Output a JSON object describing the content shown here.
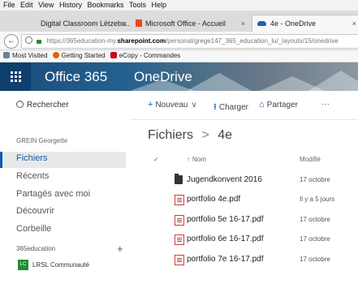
{
  "menubar": [
    "File",
    "Edit",
    "View",
    "History",
    "Bookmarks",
    "Tools",
    "Help"
  ],
  "tabs": [
    {
      "label": "Digital Classroom Lëtzebu...",
      "close": "×"
    },
    {
      "label": "Microsoft Office - Accueil",
      "close": "×"
    },
    {
      "label": "4e - OneDrive",
      "close": "×"
    }
  ],
  "nav": {
    "back": "←",
    "url_prefix": "https://365education-my.",
    "url_domain": "sharepoint.com",
    "url_suffix": "/personal/grege147_365_education_lu/_layouts/15/onedrive"
  },
  "bookmarks": [
    {
      "label": "Most Visited",
      "color": "#6d7fa0"
    },
    {
      "label": "Getting Started",
      "color": "#e66000"
    },
    {
      "label": "eCopy - Commandes",
      "color": "#d0021b"
    }
  ],
  "header": {
    "app": "Office 365",
    "product": "OneDrive"
  },
  "sidebar": {
    "search": "Rechercher",
    "owner": "GREIN Georgette",
    "items": [
      "Fichiers",
      "Récents",
      "Partagés avec moi",
      "Découvrir",
      "Corbeille"
    ],
    "group_label": "365education",
    "add": "+",
    "site_icon": "LC",
    "site": "LRSL Communauté"
  },
  "commands": {
    "new": "Nouveau",
    "upload": "Charger",
    "share": "Partager",
    "more": "···"
  },
  "breadcrumb": {
    "root": "Fichiers",
    "sep": ">",
    "current": "4e"
  },
  "columns": {
    "check": "✓",
    "name": "Nom",
    "modified": "Modifié"
  },
  "files": [
    {
      "name": "Jugendkonvent 2016",
      "modified": "17 octobre",
      "type": "folder"
    },
    {
      "name": "portfolio 4e.pdf",
      "modified": "Il y a 5 jours",
      "type": "pdf"
    },
    {
      "name": "portfolio 5e 16-17.pdf",
      "modified": "17 octobre",
      "type": "pdf"
    },
    {
      "name": "portfolio 6e 16-17.pdf",
      "modified": "17 octobre",
      "type": "pdf"
    },
    {
      "name": "portfolio 7e 16-17.pdf",
      "modified": "17 octobre",
      "type": "pdf"
    }
  ]
}
